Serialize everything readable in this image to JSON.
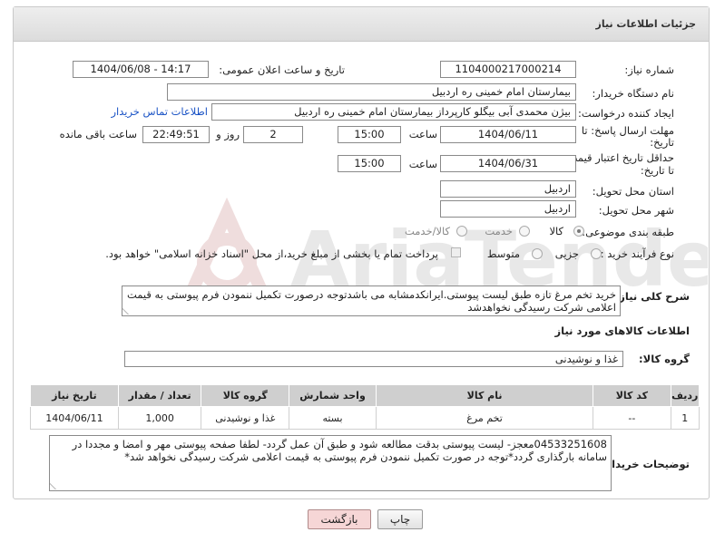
{
  "header": {
    "title": "جزئیات اطلاعات نیاز"
  },
  "form": {
    "need_number": {
      "label": "شماره نیاز:",
      "value": "1104000217000214"
    },
    "announce": {
      "label": "تاریخ و ساعت اعلان عمومی:",
      "value": "1404/06/08 - 14:17"
    },
    "buyer_org": {
      "label": "نام دستگاه خریدار:",
      "value": "بیمارستان امام خمینی  ره  اردبیل"
    },
    "requester": {
      "label": "ایجاد کننده درخواست:",
      "value": "بیژن محمدی آبی بیگلو کارپرداز بیمارستان امام خمینی  ره  اردبیل",
      "contact_link": "اطلاعات تماس خریدار"
    },
    "reply_deadline": {
      "label_line1": "مهلت ارسال پاسخ: تا",
      "label_line2": "تاریخ:",
      "date": "1404/06/11",
      "time_label": "ساعت",
      "time": "15:00",
      "days": "2",
      "days_label": "روز و",
      "remaining": "22:49:51",
      "remaining_label": "ساعت باقی مانده"
    },
    "price_validity": {
      "label_line1": "حداقل تاریخ اعتبار قیمت:",
      "label_line2": "تا تاریخ:",
      "date": "1404/06/31",
      "time_label": "ساعت",
      "time": "15:00"
    },
    "province": {
      "label": "استان محل تحویل:",
      "value": "اردبیل"
    },
    "city": {
      "label": "شهر محل تحویل:",
      "value": "اردبیل"
    },
    "category": {
      "label": "طبقه بندی موضوعی:",
      "options": [
        "کالا",
        "خدمت",
        "کالا/خدمت"
      ],
      "selected": "کالا"
    },
    "purchase_type": {
      "label": "نوع فرآیند خرید :",
      "options": [
        "جزیی",
        "متوسط"
      ],
      "payment_note": "پرداخت تمام یا بخشی از مبلغ خرید،از محل \"اسناد خزانه اسلامی\" خواهد بود."
    },
    "description": {
      "label": "شرح کلی نیاز:",
      "value": "خرید تخم مرغ تازه طبق لیست پیوستی.ایرانکدمشابه می باشدتوجه درصورت تکمیل ننمودن فرم پیوستی به قیمت اعلامی شرکت رسیدگی نخواهدشد"
    }
  },
  "goods": {
    "section_title": "اطلاعات کالاهای مورد نیاز",
    "group_label": "گروه کالا:",
    "group_value": "غذا و نوشیدنی",
    "columns": [
      "ردیف",
      "کد کالا",
      "نام کالا",
      "واحد شمارش",
      "گروه کالا",
      "تعداد / مقدار",
      "تاریخ نیاز"
    ],
    "rows": [
      [
        "1",
        "--",
        "تخم مرغ",
        "بسته",
        "غذا و نوشیدنی",
        "1,000",
        "1404/06/11"
      ]
    ]
  },
  "buyer_notes": {
    "label": "توضیحات خریدار:",
    "value": "04533251608معجز- لیست پیوستی بدقت مطالعه شود و طبق آن عمل گردد- لطفا صفحه پیوستی مهر و امضا و مجددا در سامانه بارگذاری گردد*توجه در صورت تکمیل ننمودن فرم پیوستی به قیمت اعلامی شرکت رسیدگی نخواهد شد*"
  },
  "buttons": {
    "print": "چاپ",
    "back": "بازگشت"
  },
  "colors": {
    "header_bg": "#e3e3e3",
    "link": "#1a53c5",
    "table_header": "#cfcfcf",
    "back_button_bg": "#f6d6d6"
  },
  "watermark_text": "AriaTender.neT"
}
